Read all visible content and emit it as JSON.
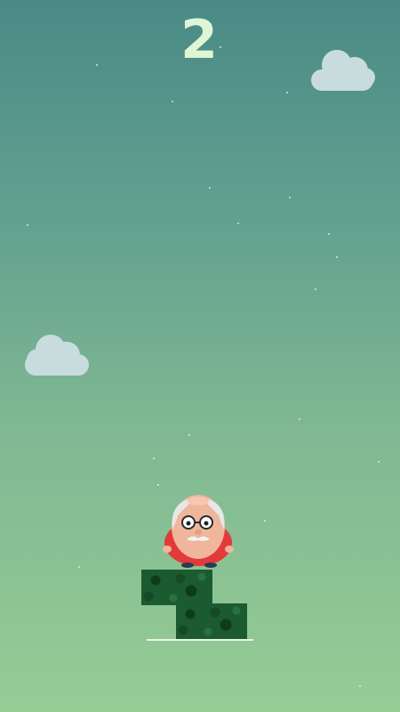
{
  "game": {
    "score": "2"
  },
  "scene": {
    "colors": {
      "sky_top": "#4a8a86",
      "sky_bottom": "#97cc95",
      "score": "#dff6d6",
      "cloud": "#c9dcdd",
      "block": "#1c5a2f",
      "ground_line": "#e9f4e9"
    },
    "blocks_stacked": 2
  },
  "character": {
    "description_icon": "old-man-with-glasses-icon"
  }
}
